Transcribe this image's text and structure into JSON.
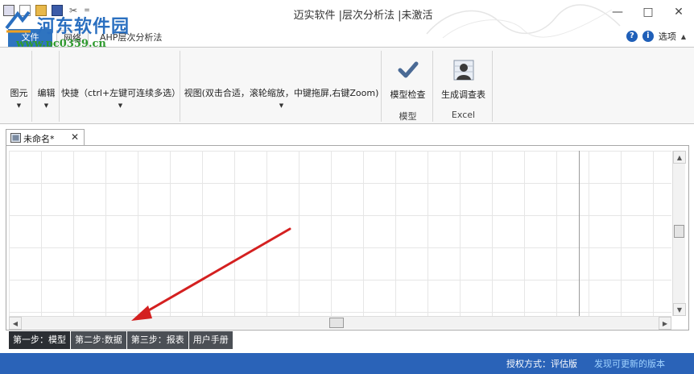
{
  "window": {
    "title": "迈实软件 |层次分析法 |未激活",
    "controls": {
      "minimize": "—",
      "maximize": "□",
      "close": "✕"
    }
  },
  "watermark": {
    "name": "河东软件园",
    "url": "www.pc0359.cn"
  },
  "quick_access": {
    "more": "="
  },
  "ribbon_tabs": {
    "file": "文件",
    "tabs": [
      {
        "label": "网络",
        "active": true
      },
      {
        "label": "AHP层次分析法",
        "active": false
      }
    ],
    "help": "?",
    "info": "i",
    "options": "选项",
    "options_caret": "▲"
  },
  "ribbon": {
    "element_group": "图元",
    "edit_group": "编辑",
    "shortcut_group": "快捷（ctrl+左键可连续多选）",
    "view_group": "视图(双击合适，滚轮缩放，中键拖屏,右键Zoom)",
    "caret": "▼",
    "model_check": "模型检查",
    "model_footer": "模型",
    "gen_survey": "生成调查表",
    "excel_footer": "Excel"
  },
  "document": {
    "tab_name": "未命名*",
    "close": "✕"
  },
  "scroll": {
    "up": "▲",
    "down": "▼",
    "left": "◀",
    "right": "▶"
  },
  "steps": [
    {
      "label": "第一步：模型",
      "active": true
    },
    {
      "label": "第二步:数据",
      "active": false
    },
    {
      "label": "第三步：报表",
      "active": false
    },
    {
      "label": "用户手册",
      "active": false
    }
  ],
  "status": {
    "license": "授权方式：评估版",
    "update": "发现可更新的版本"
  },
  "colors": {
    "accent_blue": "#2f74c0",
    "status_bar": "#2a63b8",
    "annotation_arrow": "#d42020",
    "step_tab": "#4b4f55"
  }
}
